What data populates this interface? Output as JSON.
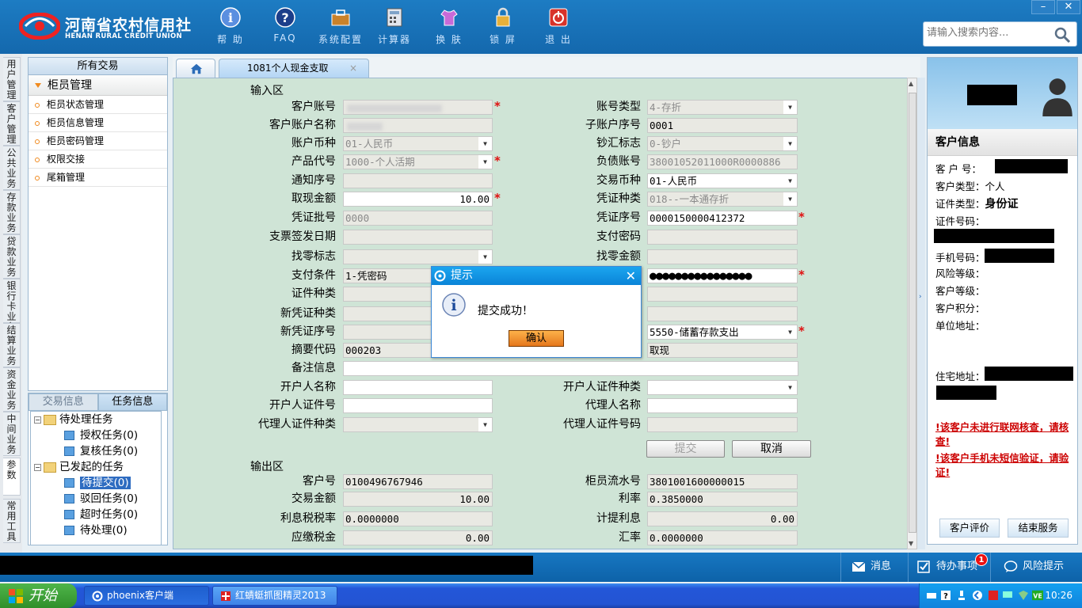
{
  "header": {
    "logo_cn": "河南省农村信用社",
    "logo_en": "HENAN RURAL CREDIT UNION",
    "tools": [
      {
        "label": "帮 助",
        "icon": "help-icon"
      },
      {
        "label": "FAQ",
        "icon": "faq-icon"
      },
      {
        "label": "系统配置",
        "icon": "toolbox-icon"
      },
      {
        "label": "计算器",
        "icon": "calculator-icon"
      },
      {
        "label": "换 肤",
        "icon": "shirt-icon"
      },
      {
        "label": "锁 屏",
        "icon": "lock-icon"
      },
      {
        "label": "退 出",
        "icon": "power-icon"
      }
    ],
    "search_placeholder": "请输入搜索内容...",
    "win_min": "–",
    "win_close": "✕"
  },
  "vtabs": [
    "用户管理",
    "客户管理",
    "公共业务",
    "存款业务",
    "贷款业务",
    "银行卡业务",
    "结算业务",
    "资金业务",
    "中间业务",
    "参数",
    "常用工具"
  ],
  "left": {
    "header": "所有交易",
    "section": "柜员管理",
    "items": [
      "柜员状态管理",
      "柜员信息管理",
      "柜员密码管理",
      "权限交接",
      "尾箱管理"
    ]
  },
  "tasks": {
    "tab1": "交易信息",
    "tab2": "任务信息",
    "pending": "待处理任务",
    "pending_items": [
      "授权任务(0)",
      "复核任务(0)"
    ],
    "sent": "已发起的任务",
    "sent_items": [
      "待提交(0)",
      "驳回任务(0)",
      "超时任务(0)",
      "待处理(0)"
    ]
  },
  "tab": {
    "label": "1081个人现金支取",
    "close": "×"
  },
  "form": {
    "input_area": "输入区",
    "output_area": "输出区",
    "left_labels": [
      "客户账号",
      "客户账户名称",
      "账户币种",
      "产品代号",
      "通知序号",
      "取现金额",
      "凭证批号",
      "支票签发日期",
      "找零标志",
      "支付条件",
      "证件种类",
      "新凭证种类",
      "新凭证序号",
      "摘要代码",
      "备注信息",
      "开户人名称",
      "开户人证件号",
      "代理人证件种类"
    ],
    "left_values": [
      "",
      "",
      "01-人民币",
      "1000-个人活期",
      "",
      "10.00",
      "0000",
      "",
      "",
      "1-凭密码",
      "",
      "",
      "",
      "000203",
      "",
      "",
      "",
      ""
    ],
    "right_labels": [
      "账号类型",
      "子账户序号",
      "钞汇标志",
      "负债账号",
      "交易币种",
      "凭证种类",
      "凭证序号",
      "支付密码",
      "找零金额",
      "",
      "",
      "",
      "",
      "",
      "",
      "开户人证件种类",
      "代理人名称",
      "代理人证件号码"
    ],
    "right_values": [
      "4-存折",
      "0001",
      "0-钞户",
      "38001052011000R0000886",
      "01-人民币",
      "018--一本通存折",
      "0000150000412372",
      "",
      "",
      "●●●●●●●●●●●●●●●●",
      "",
      "",
      "5550-储蓄存款支出",
      "取现",
      "",
      "",
      "",
      ""
    ],
    "submit": "提交",
    "cancel": "取消",
    "out_left_labels": [
      "客户号",
      "交易金额",
      "利息税税率",
      "应缴税金"
    ],
    "out_left_values": [
      "0100496767946",
      "10.00",
      "0.0000000",
      "0.00"
    ],
    "out_right_labels": [
      "柜员流水号",
      "利率",
      "计提利息",
      "汇率"
    ],
    "out_right_values": [
      "3801001600000015",
      "0.3850000",
      "0.00",
      "0.0000000"
    ]
  },
  "dialog": {
    "title": "提示",
    "message": "提交成功！",
    "ok": "确认",
    "close": "✕"
  },
  "customer": {
    "title": "客户信息",
    "labels": [
      "客 户 号：",
      "客户类型：",
      "证件类型：",
      "证件号码：",
      "手机号码：",
      "风险等级：",
      "客户等级：",
      "客户积分：",
      "单位地址：",
      "住宅地址："
    ],
    "type_value": "个人",
    "id_type_value": "身份证",
    "warn1": "!该客户未进行联网核查，请核查!",
    "warn2": "!该客户手机未短信验证，请验证!",
    "btn_eval": "客户评价",
    "btn_end": "结束服务"
  },
  "status": {
    "msg": "消息",
    "todo": "待办事项",
    "todo_count": "1",
    "risk": "风险提示"
  },
  "taskbar": {
    "start": "开始",
    "apps": [
      "phoenix客户端",
      "红蜻蜓抓图精灵2013"
    ],
    "time": "10:26"
  }
}
